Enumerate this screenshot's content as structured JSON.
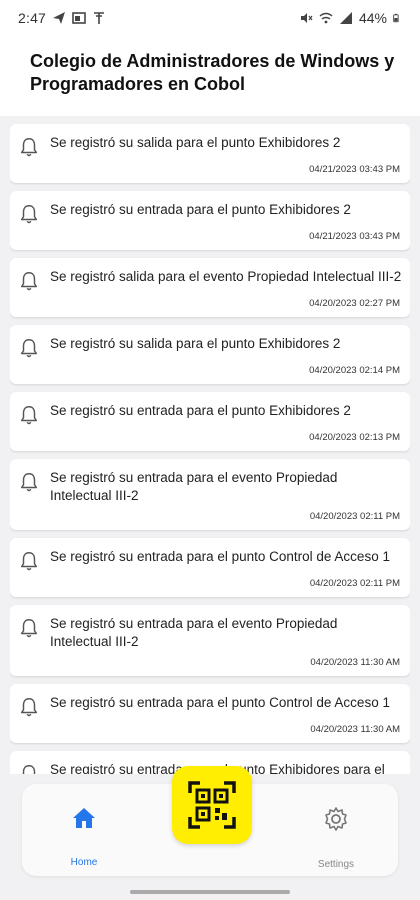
{
  "status_bar": {
    "time": "2:47",
    "battery": "44%"
  },
  "header": {
    "title": "Colegio de Administradores de Windows y Programadores en Cobol"
  },
  "notifications": [
    {
      "message": "Se registró su salida para el punto Exhibidores 2",
      "timestamp": "04/21/2023 03:43 PM"
    },
    {
      "message": "Se registró su entrada para el punto Exhibidores 2",
      "timestamp": "04/21/2023 03:43 PM"
    },
    {
      "message": "Se registró salida para el evento Propiedad Intelectual III-2",
      "timestamp": "04/20/2023 02:27 PM"
    },
    {
      "message": "Se registró su salida para el punto Exhibidores 2",
      "timestamp": "04/20/2023 02:14 PM"
    },
    {
      "message": "Se registró su entrada para el punto Exhibidores 2",
      "timestamp": "04/20/2023 02:13 PM"
    },
    {
      "message": "Se registró su entrada para el evento Propiedad Intelectual III-2",
      "timestamp": "04/20/2023 02:11 PM"
    },
    {
      "message": "Se registró su entrada para el punto Control de Acceso 1",
      "timestamp": "04/20/2023 02:11 PM"
    },
    {
      "message": "Se registró su entrada para el evento Propiedad Intelectual III-2",
      "timestamp": "04/20/2023 11:30 AM"
    },
    {
      "message": "Se registró su entrada para el punto Control de Acceso 1",
      "timestamp": "04/20/2023 11:30 AM"
    },
    {
      "message": "Se registró su entrada para el punto Exhibidores para el punto de acceso, donde Jugaran XBOX",
      "timestamp": ""
    }
  ],
  "nav": {
    "home_label": "Home",
    "settings_label": "Settings"
  },
  "colors": {
    "accent": "#2477e8",
    "qr_button": "#ffee00"
  },
  "icons": {
    "notification": "bell-icon",
    "home": "home-icon",
    "settings": "gear-icon",
    "scan": "qr-code-icon"
  }
}
